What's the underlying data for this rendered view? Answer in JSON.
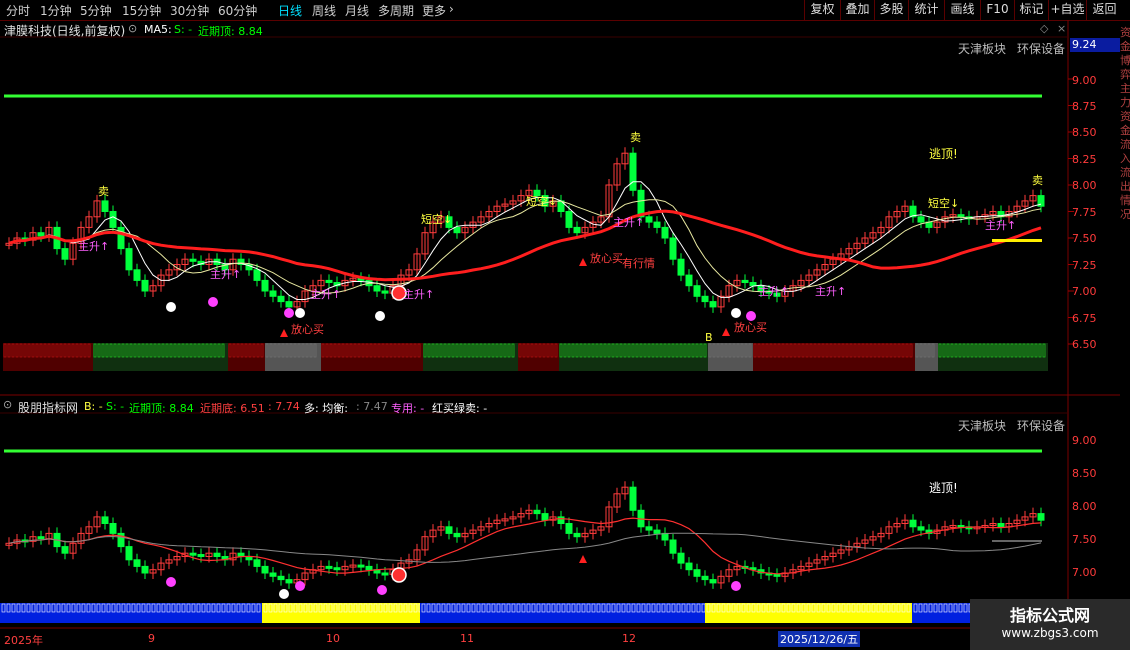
{
  "toolbar": {
    "periods": [
      "分时",
      "1分钟",
      "5分钟",
      "15分钟",
      "30分钟",
      "60分钟",
      "日线",
      "周线",
      "月线",
      "多周期",
      "更多"
    ],
    "active": "日线",
    "right_buttons": [
      "复权",
      "叠加",
      "多股",
      "统计",
      "画线",
      "F10",
      "标记",
      "+自选",
      "返回"
    ]
  },
  "top_panel": {
    "stock_title": "津膜科技(日线,前复权)",
    "indicator": "MA5:",
    "s_label": "S: -",
    "peak_label": "近期顶: 8.84",
    "sector1": "天津板块",
    "sector2": "环保设备",
    "price_box": "9.24",
    "y_ticks": [
      "9.00",
      "8.75",
      "8.50",
      "8.25",
      "8.00",
      "7.75",
      "7.50",
      "7.25",
      "7.00",
      "6.75",
      "6.50"
    ],
    "annotations": {
      "sell": "卖",
      "short_empty": "短空↓",
      "main_up": "主升↑",
      "escape_top": "逃顶!",
      "buy_safe": "放心买",
      "market": "有行情",
      "b_mark": "B"
    },
    "side_text": "资金博弈主力资金流入流出情况"
  },
  "bottom_panel": {
    "name": "股朋指标网",
    "b_label": "B: -",
    "s_label": "S: -",
    "peak_label": "近期顶: 8.84",
    "bottom_label": "近期底: 6.51",
    "range_value": ": 7.74",
    "multi_label": "多: 均衡:",
    "balance_value": ": 7.47",
    "special_label": "专用: -",
    "rg_label": "红买绿卖: -",
    "sector1": "天津板块",
    "sector2": "环保设备",
    "y_ticks": [
      "9.00",
      "8.50",
      "8.00",
      "7.50",
      "7.00"
    ],
    "escape_top": "逃顶!"
  },
  "date_axis": {
    "labels": [
      "2025年",
      "9",
      "10",
      "11",
      "12"
    ],
    "highlight": "2025/12/26/五"
  },
  "watermark": {
    "title": "指标公式网",
    "url": "www.zbgs3.com"
  },
  "colors": {
    "bull": "#ff3c3c",
    "bear": "#00ff3c",
    "ma_long": "#ff1e1e",
    "resistance": "#33ff33",
    "accent": "#00e0ff"
  }
}
